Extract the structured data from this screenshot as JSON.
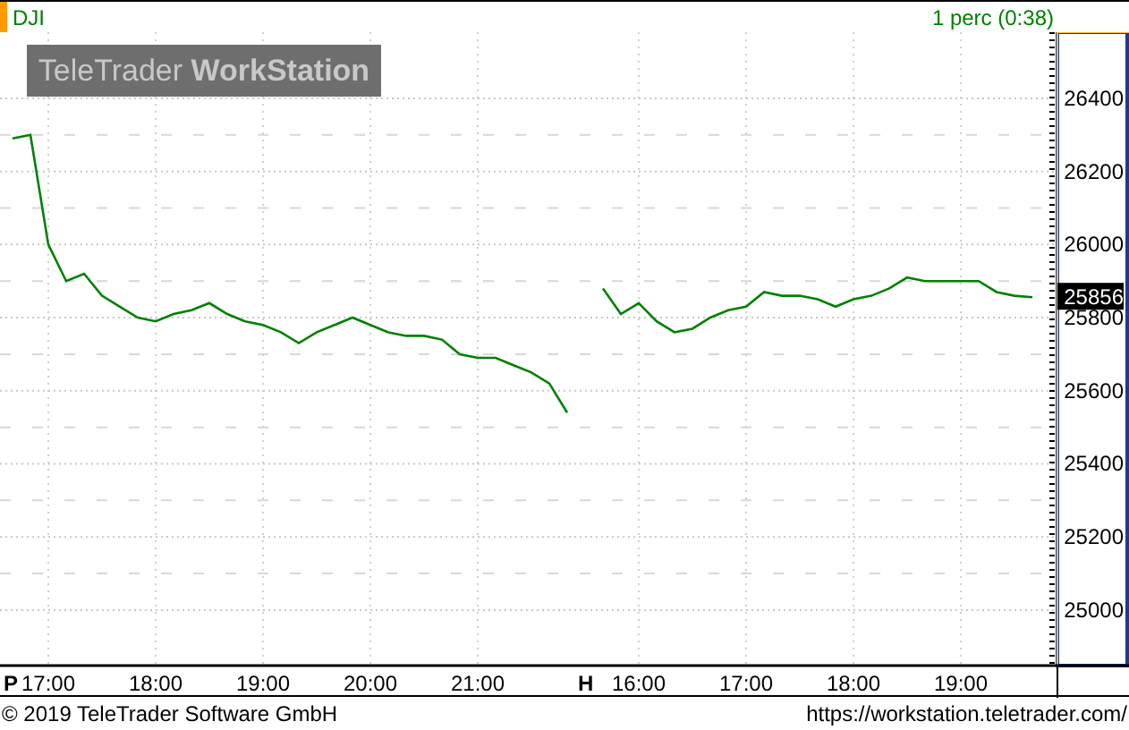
{
  "header": {
    "interval": "1 perc (0:38)"
  },
  "watermark": {
    "text": "TeleTrader **WorkStation**"
  },
  "chart": {
    "last_price": "25856",
    "chart_data": {
      "type": "line",
      "categories": [
        null,
        null,
        "17:00",
        null,
        null,
        null,
        null,
        null,
        "18:00",
        null,
        null,
        null,
        null,
        null,
        "19:00",
        null,
        null,
        null,
        null,
        null,
        "20:00",
        null,
        null,
        null,
        null,
        null,
        "21:00",
        null,
        null,
        null,
        null,
        null,
        null,
        null,
        null,
        "16:00",
        null,
        null,
        null,
        null,
        null,
        "17:00",
        null,
        null,
        null,
        null,
        null,
        "18:00",
        null,
        null,
        null,
        null,
        null,
        "19:00",
        null,
        null,
        null,
        null
      ],
      "series": [
        {
          "name": "DJI",
          "color": "#008000",
          "values": [
            26290,
            26300,
            26000,
            25900,
            25920,
            25860,
            25830,
            25800,
            25790,
            25810,
            25820,
            25840,
            25810,
            25790,
            25780,
            25760,
            25730,
            25760,
            25780,
            25800,
            25780,
            25760,
            25750,
            25750,
            25740,
            25700,
            25690,
            25690,
            25670,
            25650,
            25620,
            25540,
            null,
            25880,
            25810,
            25840,
            25790,
            25760,
            25770,
            25800,
            25820,
            25830,
            25870,
            25860,
            25860,
            25850,
            25830,
            25850,
            25860,
            25880,
            25910,
            25900,
            25900,
            25900,
            25900,
            25870,
            25860,
            25856
          ]
        }
      ],
      "ylim": [
        24848,
        26581
      ],
      "yticks": [
        25000,
        25200,
        25400,
        25600,
        25800,
        26000,
        26200,
        26400
      ],
      "grid": true
    },
    "session_markers": [
      "P",
      "H"
    ]
  },
  "footer": {
    "copyright": "© 2019 TeleTrader Software GmbH",
    "url": "https://workstation.teletrader.com/"
  }
}
